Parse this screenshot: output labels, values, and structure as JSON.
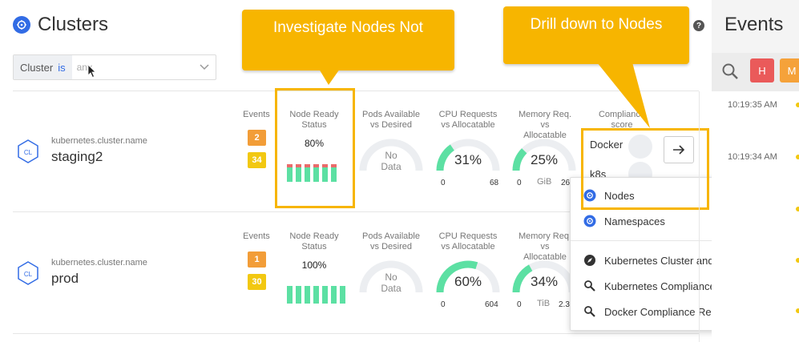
{
  "header": {
    "title": "Clusters",
    "filter": {
      "label": "Cluster",
      "operator": "is",
      "placeholder": "any"
    }
  },
  "columns": {
    "events": "Events",
    "node_ready": [
      "Node Ready",
      "Status"
    ],
    "pods": [
      "Pods Available",
      "vs Desired"
    ],
    "cpu": [
      "CPU Requests",
      "vs Allocatable"
    ],
    "memory": [
      "Memory Req. vs",
      "Allocatable"
    ],
    "compliance": [
      "Compliance",
      "score"
    ]
  },
  "clusters": [
    {
      "badge": "CL",
      "name_label": "kubernetes.cluster.name",
      "name": "staging2",
      "events": {
        "orange": "2",
        "yellow": "34"
      },
      "node_ready": {
        "pct": "80%",
        "bars_total": 6,
        "bars_red": 6
      },
      "pods": {
        "nodata": [
          "No",
          "Data"
        ]
      },
      "cpu": {
        "value": "31%",
        "fraction": 0.31,
        "min": "0",
        "max": "68"
      },
      "memory": {
        "value": "25%",
        "fraction": 0.25,
        "min": "0",
        "unit": "GiB",
        "max": "26"
      },
      "compliance": {
        "rows": [
          "Docker",
          "k8s"
        ]
      }
    },
    {
      "badge": "CL",
      "name_label": "kubernetes.cluster.name",
      "name": "prod",
      "events": {
        "orange": "1",
        "yellow": "30"
      },
      "node_ready": {
        "pct": "100%",
        "bars_total": 7,
        "bars_red": 0
      },
      "pods": {
        "nodata": [
          "No",
          "Data"
        ]
      },
      "cpu": {
        "value": "60%",
        "fraction": 0.6,
        "min": "0",
        "max": "604"
      },
      "memory": {
        "value": "34%",
        "fraction": 0.34,
        "min": "0",
        "unit": "TiB",
        "max": "2.3"
      }
    }
  ],
  "callouts": {
    "investigate": "Investigate Nodes Not",
    "drill": "Drill down to Nodes"
  },
  "menu": {
    "items": [
      {
        "label": "Nodes",
        "icon": "kubernetes-icon"
      },
      {
        "label": "Namespaces",
        "icon": "kubernetes-icon"
      },
      {
        "label": "Kubernetes Cluster and Node Capacity",
        "icon": "compass-icon"
      },
      {
        "label": "Kubernetes Compliance Report",
        "icon": "report-icon"
      },
      {
        "label": "Docker Compliance Report",
        "icon": "report-icon"
      }
    ]
  },
  "events_panel": {
    "title": "Events",
    "buttons": {
      "high": "H",
      "medium": "M"
    },
    "times": [
      "10:19:35 AM",
      "10:19:34 AM"
    ]
  },
  "colors": {
    "accent": "#326ce5",
    "callout": "#f7b500",
    "gauge": "#5ce0a3",
    "badge_orange": "#f29d38",
    "badge_yellow": "#f2c811",
    "high": "#ea5a5a",
    "medium": "#f5a23a"
  }
}
